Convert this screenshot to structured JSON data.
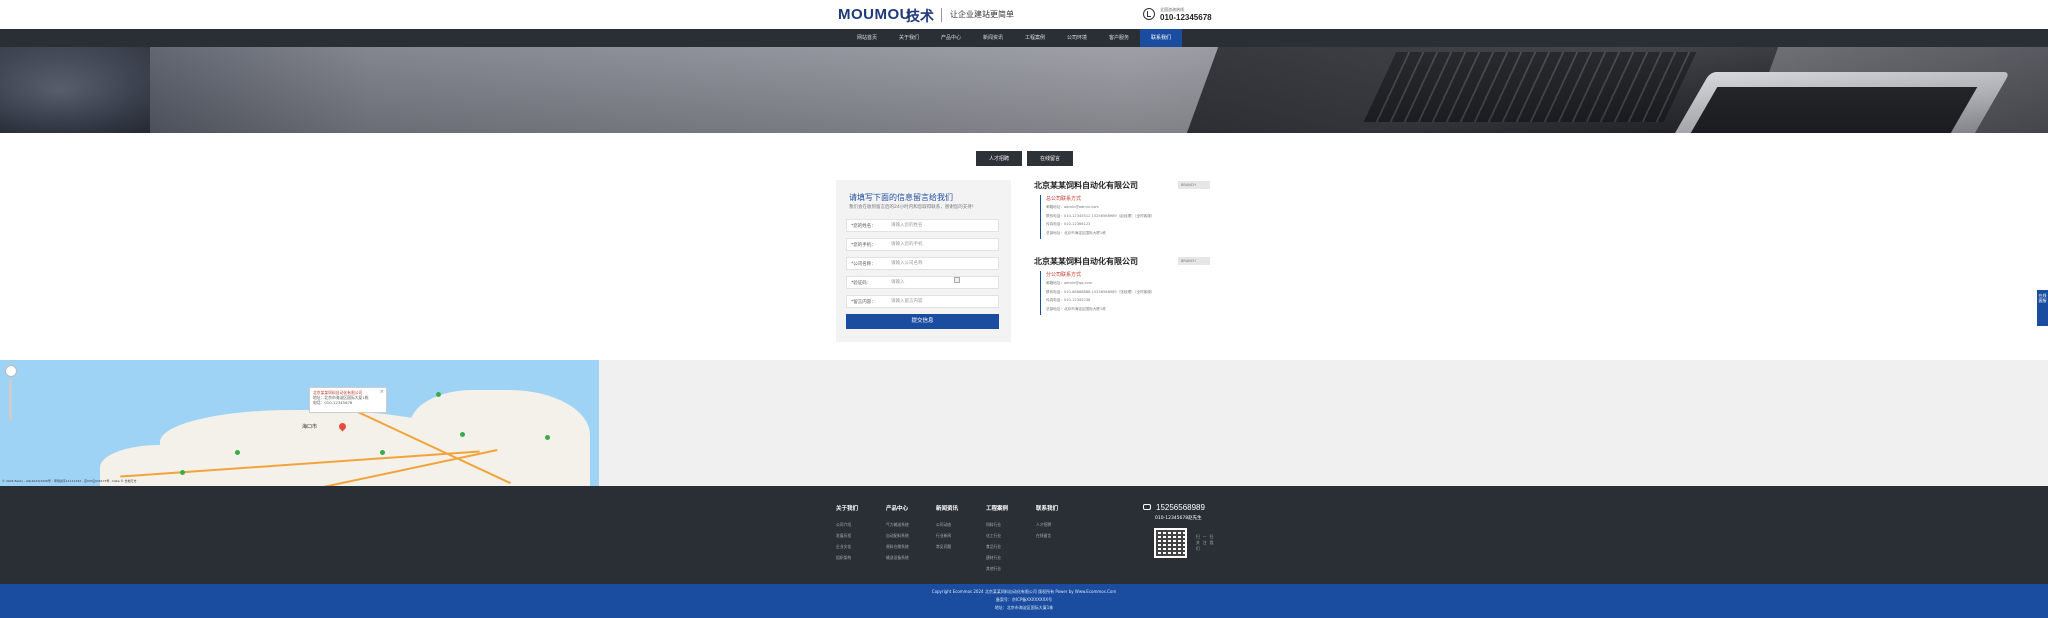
{
  "header": {
    "logo_en": "MOUMOU",
    "logo_cn": "技术",
    "slogan": "让企业建站更简单",
    "hotline_label": "全国咨询热线",
    "hotline": "010-12345678"
  },
  "nav": {
    "items": [
      {
        "label": "网站首页"
      },
      {
        "label": "关于我们"
      },
      {
        "label": "产品中心"
      },
      {
        "label": "新闻资讯"
      },
      {
        "label": "工程案例"
      },
      {
        "label": "公司环境"
      },
      {
        "label": "客户服务"
      },
      {
        "label": "联系我们"
      }
    ],
    "active_index": 7
  },
  "tabs": {
    "talent": "人才招聘",
    "message": "在线留言"
  },
  "form": {
    "title": "请填写下面的信息留言给我们",
    "subtitle": "我们会在收到留言后的24小时内和您取得联系，感谢您的支持！",
    "fields": [
      {
        "label": "*您的姓名：",
        "placeholder": "请输入您的姓名"
      },
      {
        "label": "*您的手机：",
        "placeholder": "请输入您的手机"
      },
      {
        "label": "*公司名称：",
        "placeholder": "请输入公司名称"
      },
      {
        "label": "*验证码：",
        "placeholder": "请输入"
      },
      {
        "label": "*留言内容：",
        "placeholder": "请输入留言内容"
      }
    ],
    "submit": "提交信息"
  },
  "companies": [
    {
      "name": "北京某某饲料自动化有限公司",
      "tag": "BRANCH",
      "contact_title": "总公司联系方式",
      "lines": [
        "邮箱地址：admin@admin.com",
        "联系电话：010-12345512  15256568989（赵经理）（全时客服）",
        "传真电话：010-12366123",
        "总部地址：北京市海淀区国际大厦1栋"
      ]
    },
    {
      "name": "北京某某饲料自动化有限公司",
      "tag": "BRANCH",
      "contact_title": "分公司联系方式",
      "lines": [
        "邮箱地址：admin@qq.com",
        "联系电话：010-88888888  15256568989（张经理）（全时客服）",
        "传真电话：010-12345236",
        "总部地址：北京市海淀区国际大厦1栋"
      ]
    }
  ],
  "map": {
    "info_title": "北京某某饲料自动化有限公司",
    "info_addr": "地址：北京市海淀区国际大厦1栋",
    "info_tel": "电话：010-12345678",
    "city_label": "海口市",
    "copyright": "© 2024 Baidu - GS(2023)3206号 - 甲测资字11111342 - 京ICP证030173号 - Data © 长地万方"
  },
  "footer": {
    "columns": [
      {
        "title": "关于我们",
        "items": [
          "公司介绍",
          "发展历程",
          "企业文化",
          "组织架构"
        ]
      },
      {
        "title": "产品中心",
        "items": [
          "气力输送系统",
          "自动配料系统",
          "原料仓储系统",
          "输送设备系统"
        ]
      },
      {
        "title": "新闻资讯",
        "items": [
          "公司动态",
          "行业新闻",
          "常见问题"
        ]
      },
      {
        "title": "工程案例",
        "items": [
          "饲料行业",
          "化工行业",
          "食品行业",
          "建材行业",
          "其他行业"
        ]
      },
      {
        "title": "联系我们",
        "items": [
          "人才招聘",
          "在线留言"
        ]
      }
    ],
    "phone": "15256568989",
    "phone_sub": "010-12345678赵先生",
    "qr_text": [
      "扫一扫",
      "关注我",
      "们"
    ]
  },
  "copyright": {
    "line1": "Copyright Ecommos 2024 北京某某饲料自动化有限公司 版权所有  Power by Www.Ecommos.Com",
    "line2": "备案号：京ICP备XXXXXXXX号",
    "line3": "地址：北京市海淀区国际大厦1栋"
  },
  "side_tab": "在线客服",
  "colors": {
    "brand_blue": "#1a4da0",
    "nav_dark": "#2a2f36",
    "accent_red": "#c0392b"
  }
}
